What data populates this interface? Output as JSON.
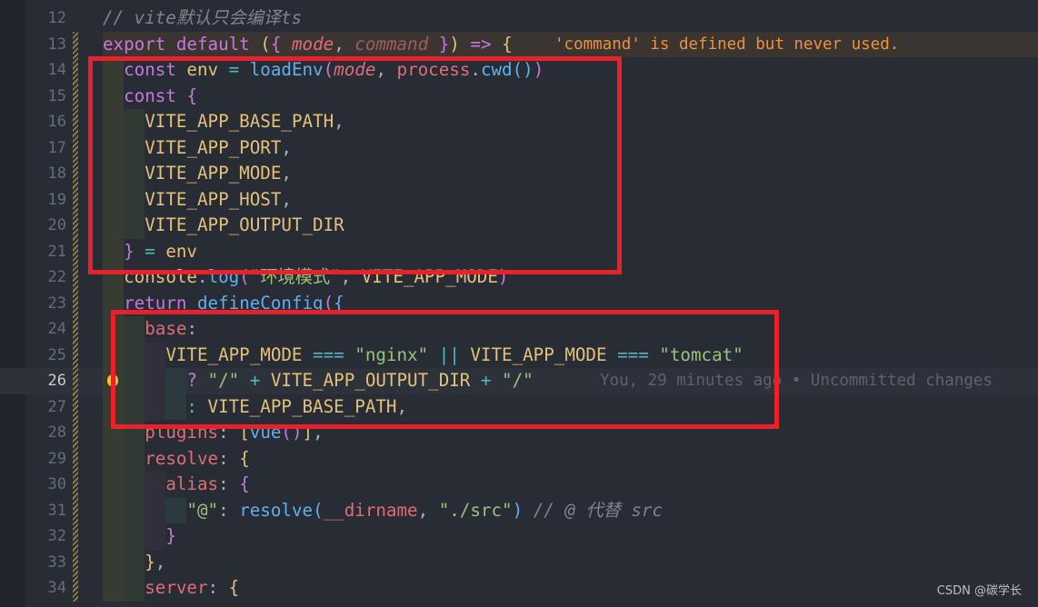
{
  "editor": {
    "current_line": 26,
    "colors": {
      "background": "#282c34",
      "highlight_box": "#e8212a",
      "diagnostic": "#f0913a"
    },
    "lines": [
      {
        "num": 12,
        "indent": 0,
        "tokens": [
          [
            "// vite默认只会编译ts",
            "cm"
          ]
        ]
      },
      {
        "num": 13,
        "indent": 0,
        "tokens": [
          [
            "export",
            "kw"
          ],
          [
            " default ",
            "kw"
          ],
          [
            "(",
            "b1"
          ],
          [
            "{",
            "b2"
          ],
          [
            " ",
            "pl"
          ],
          [
            "mode",
            "param"
          ],
          [
            ", ",
            "pl"
          ],
          [
            "command",
            "param-dim"
          ],
          [
            " ",
            "pl"
          ],
          [
            "}",
            "b2"
          ],
          [
            ")",
            "b1"
          ],
          [
            " => ",
            "kw"
          ],
          [
            "{",
            "b1"
          ]
        ],
        "diagnostic": "'command' is defined but never used."
      },
      {
        "num": 14,
        "indent": 1,
        "tokens": [
          [
            "const",
            "kw"
          ],
          [
            " env",
            "var"
          ],
          [
            " = ",
            "op"
          ],
          [
            "loadEnv",
            "fn"
          ],
          [
            "(",
            "b2"
          ],
          [
            "mode",
            "param"
          ],
          [
            ", ",
            "pl"
          ],
          [
            "process",
            "prop"
          ],
          [
            ".",
            "pl"
          ],
          [
            "cwd",
            "fn"
          ],
          [
            "()",
            "b3"
          ],
          [
            ")",
            "b2"
          ]
        ]
      },
      {
        "num": 15,
        "indent": 1,
        "tokens": [
          [
            "const",
            "kw"
          ],
          [
            " ",
            "pl"
          ],
          [
            "{",
            "b2"
          ]
        ]
      },
      {
        "num": 16,
        "indent": 2,
        "tokens": [
          [
            "VITE_APP_BASE_PATH",
            "var"
          ],
          [
            ",",
            "pl"
          ]
        ]
      },
      {
        "num": 17,
        "indent": 2,
        "tokens": [
          [
            "VITE_APP_PORT",
            "var"
          ],
          [
            ",",
            "pl"
          ]
        ]
      },
      {
        "num": 18,
        "indent": 2,
        "tokens": [
          [
            "VITE_APP_MODE",
            "var"
          ],
          [
            ",",
            "pl"
          ]
        ]
      },
      {
        "num": 19,
        "indent": 2,
        "tokens": [
          [
            "VITE_APP_HOST",
            "var"
          ],
          [
            ",",
            "pl"
          ]
        ]
      },
      {
        "num": 20,
        "indent": 2,
        "tokens": [
          [
            "VITE_APP_OUTPUT_DIR",
            "var"
          ]
        ]
      },
      {
        "num": 21,
        "indent": 1,
        "tokens": [
          [
            "}",
            "b2"
          ],
          [
            " = ",
            "op"
          ],
          [
            "env",
            "var"
          ]
        ]
      },
      {
        "num": 22,
        "indent": 1,
        "tokens": [
          [
            "console",
            "var"
          ],
          [
            ".",
            "pl"
          ],
          [
            "log",
            "fn"
          ],
          [
            "(",
            "b2"
          ],
          [
            "\"环境模式\"",
            "str"
          ],
          [
            ", ",
            "pl"
          ],
          [
            "VITE_APP_MODE",
            "var"
          ],
          [
            ")",
            "b2"
          ]
        ]
      },
      {
        "num": 23,
        "indent": 1,
        "tokens": [
          [
            "return",
            "kw"
          ],
          [
            " ",
            "pl"
          ],
          [
            "defineConfig",
            "fn"
          ],
          [
            "(",
            "b2"
          ],
          [
            "{",
            "b3"
          ]
        ]
      },
      {
        "num": 24,
        "indent": 2,
        "tokens": [
          [
            "base",
            "prop"
          ],
          [
            ":",
            "pl"
          ]
        ]
      },
      {
        "num": 25,
        "indent": 3,
        "tokens": [
          [
            "VITE_APP_MODE",
            "var"
          ],
          [
            " === ",
            "op"
          ],
          [
            "\"nginx\"",
            "str"
          ],
          [
            " || ",
            "op"
          ],
          [
            "VITE_APP_MODE",
            "var"
          ],
          [
            " === ",
            "op"
          ],
          [
            "\"tomcat\"",
            "str"
          ]
        ]
      },
      {
        "num": 26,
        "indent": 4,
        "tokens": [
          [
            "?",
            "kw"
          ],
          [
            " \"/\"",
            "str"
          ],
          [
            " + ",
            "op"
          ],
          [
            "VITE_APP_OUTPUT_DIR",
            "var"
          ],
          [
            " + ",
            "op"
          ],
          [
            "\"/\"",
            "str"
          ]
        ],
        "blame": "You, 29 minutes ago • Uncommitted changes",
        "lightbulb": true
      },
      {
        "num": 27,
        "indent": 4,
        "tokens": [
          [
            ":",
            "op"
          ],
          [
            " VITE_APP_BASE_PATH",
            "var"
          ],
          [
            ",",
            "pl"
          ]
        ]
      },
      {
        "num": 28,
        "indent": 2,
        "tokens": [
          [
            "plugins",
            "prop"
          ],
          [
            ": ",
            "pl"
          ],
          [
            "[",
            "b1"
          ],
          [
            "vue",
            "fn"
          ],
          [
            "()",
            "b2"
          ],
          [
            "]",
            "b1"
          ],
          [
            ",",
            "pl"
          ]
        ]
      },
      {
        "num": 29,
        "indent": 2,
        "tokens": [
          [
            "resolve",
            "prop"
          ],
          [
            ": ",
            "pl"
          ],
          [
            "{",
            "b1"
          ]
        ]
      },
      {
        "num": 30,
        "indent": 3,
        "tokens": [
          [
            "alias",
            "prop"
          ],
          [
            ": ",
            "pl"
          ],
          [
            "{",
            "b2"
          ]
        ]
      },
      {
        "num": 31,
        "indent": 4,
        "tokens": [
          [
            "\"@\"",
            "str"
          ],
          [
            ": ",
            "pl"
          ],
          [
            "resolve",
            "fn"
          ],
          [
            "(",
            "b3"
          ],
          [
            "__dirname",
            "prop"
          ],
          [
            ", ",
            "pl"
          ],
          [
            "\"./src\"",
            "str"
          ],
          [
            ")",
            "b3"
          ],
          [
            " // @ 代替 src",
            "cm"
          ]
        ]
      },
      {
        "num": 32,
        "indent": 3,
        "tokens": [
          [
            "}",
            "b2"
          ]
        ]
      },
      {
        "num": 33,
        "indent": 2,
        "tokens": [
          [
            "}",
            "b1"
          ],
          [
            ",",
            "pl"
          ]
        ]
      },
      {
        "num": 34,
        "indent": 2,
        "tokens": [
          [
            "server",
            "prop"
          ],
          [
            ": ",
            "pl"
          ],
          [
            "{",
            "b1"
          ]
        ]
      }
    ]
  },
  "watermark": "CSDN @碳学长"
}
